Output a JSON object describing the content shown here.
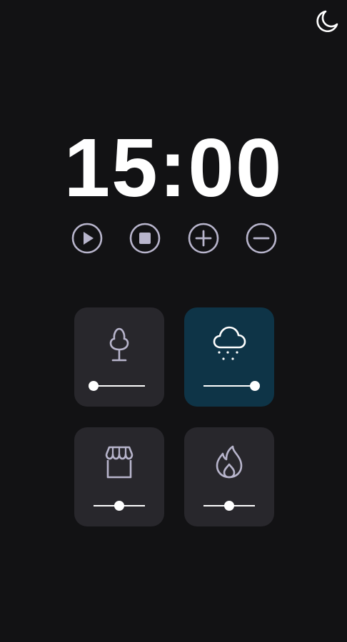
{
  "theme_toggle": {
    "icon": "moon-icon"
  },
  "timer": {
    "display": "15:00"
  },
  "controls": [
    {
      "name": "play-button",
      "icon": "play-icon"
    },
    {
      "name": "stop-button",
      "icon": "stop-icon"
    },
    {
      "name": "increase-button",
      "icon": "plus-icon"
    },
    {
      "name": "decrease-button",
      "icon": "minus-icon"
    }
  ],
  "sounds": [
    {
      "name": "forest",
      "icon": "tree-icon",
      "active": false,
      "volume": 0.0
    },
    {
      "name": "rain",
      "icon": "rain-cloud-icon",
      "active": true,
      "volume": 1.0
    },
    {
      "name": "coffee-shop",
      "icon": "storefront-icon",
      "active": false,
      "volume": 0.5
    },
    {
      "name": "fireplace",
      "icon": "flame-icon",
      "active": false,
      "volume": 0.5
    }
  ],
  "colors": {
    "background": "#121214",
    "card": "#28272c",
    "card_active": "#0e3447",
    "icon": "#b8b5cc",
    "text": "#ffffff"
  }
}
